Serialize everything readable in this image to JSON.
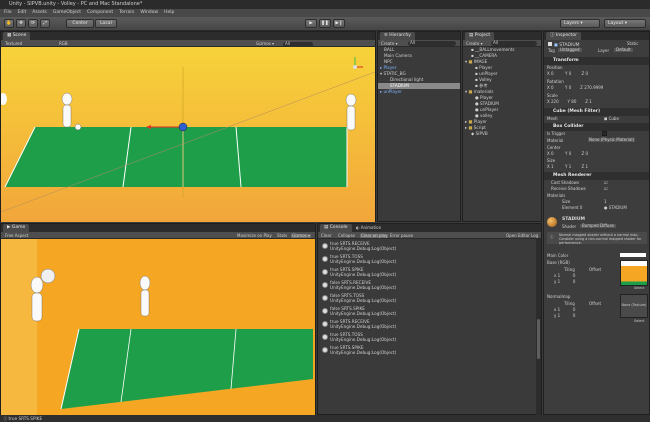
{
  "window": {
    "title": "Unity - SIPVB.unity - Volley - PC and Mac Standalone*"
  },
  "menu": [
    "File",
    "Edit",
    "Assets",
    "GameObject",
    "Component",
    "Terrain",
    "Window",
    "Help"
  ],
  "toolbar": {
    "center": "Center",
    "local": "Local",
    "layers": "Layers",
    "layout": "Layout"
  },
  "scene": {
    "tab": "Scene",
    "shading": "Textured",
    "mode": "RGB",
    "gizmos": "Gizmos ▾",
    "search": "All"
  },
  "game": {
    "tab": "Game",
    "aspect": "Free Aspect",
    "maximize": "Maximize on Play",
    "stats": "Stats",
    "gizmos": "Gizmos ▾"
  },
  "hierarchy": {
    "tab": "Hierarchy",
    "create": "Create ▾",
    "search": "All",
    "items": [
      "BALL",
      "Main Camera",
      "NPC",
      "Player",
      "STATIC_BG",
      "Directional light",
      "STADIUM",
      "unPlayer"
    ]
  },
  "project": {
    "tab": "Project",
    "create": "Create ▾",
    "search": "All",
    "items": [
      "__BALLmovements",
      "__CAMERA",
      "IMAGE",
      "Player",
      "unPlayer",
      "Volley",
      "参考",
      "materials",
      "Player",
      "STADIUM",
      "unPlayer",
      "volley",
      "Player",
      "Script",
      "SIPVB"
    ]
  },
  "console": {
    "tab": "Console",
    "anim_tab": "Animation",
    "clear": "Clear",
    "collapse": "Collapse",
    "clear_on_play": "Clear on play",
    "error_pause": "Error pause",
    "open_editor_log": "Open Editor Log",
    "rows": [
      [
        "true SRTS.RECEIVE",
        "UnityEngine.Debug:Log(Object)"
      ],
      [
        "true SRTS.TOSS",
        "UnityEngine.Debug:Log(Object)"
      ],
      [
        "true SRTS.SPIKE",
        "UnityEngine.Debug:Log(Object)"
      ],
      [
        "false SRTS.RECEIVE",
        "UnityEngine.Debug:Log(Object)"
      ],
      [
        "false SRTS.TOSS",
        "UnityEngine.Debug:Log(Object)"
      ],
      [
        "false SRTS.SPIKE",
        "UnityEngine.Debug:Log(Object)"
      ],
      [
        "true SRTS.RECEIVE",
        "UnityEngine.Debug:Log(Object)"
      ],
      [
        "true SRTS.TOSS",
        "UnityEngine.Debug:Log(Object)"
      ],
      [
        "true SRTS.SPIKE",
        "UnityEngine.Debug:Log(Object)"
      ]
    ]
  },
  "status": {
    "text": "true SRTS.SPIKE"
  },
  "inspector": {
    "tab": "Inspector",
    "object_name": "STADIUM",
    "static": "Static",
    "tag_label": "Tag",
    "tag_value": "Untagged",
    "layer_label": "Layer",
    "layer_value": "Default",
    "transform": {
      "title": "Transform",
      "position": "Position",
      "rotation": "Rotation",
      "scale": "Scale",
      "pos": [
        "0",
        "0",
        "0"
      ],
      "rot": [
        "0",
        "0",
        "270.9999"
      ],
      "scl": [
        "220",
        "80",
        "1"
      ]
    },
    "mesh_filter": {
      "title": "Cube (Mesh Filter)",
      "mesh_label": "Mesh",
      "mesh_value": "Cube"
    },
    "box_collider": {
      "title": "Box Collider",
      "is_trigger": "Is Trigger",
      "material": "Material",
      "material_value": "None (Physic Material)",
      "center": "Center",
      "center_vals": [
        "0",
        "0",
        "0"
      ],
      "size": "Size",
      "size_vals": [
        "1",
        "1",
        "1"
      ]
    },
    "mesh_renderer": {
      "title": "Mesh Renderer",
      "cast": "Cast Shadows",
      "receive": "Receive Shadows",
      "materials": "Materials",
      "size_label": "Size",
      "size_val": "1",
      "element_label": "Element 0",
      "element_val": "STADIUM"
    },
    "material": {
      "name": "STADIUM",
      "shader_label": "Shader",
      "shader_value": "Bumped Diffuse",
      "help": "Normal mapped shader without a normal map. Consider using a non-normal mapped shader for performance.",
      "main_color": "Main Color",
      "base": "Base (RGB)",
      "tiling": "Tiling",
      "offset": "Offset",
      "normalmap": "Normalmap",
      "none_texture": "None (Texture)",
      "select": "Select",
      "x": "x",
      "y": "y",
      "one": "1",
      "zero": "0"
    }
  }
}
